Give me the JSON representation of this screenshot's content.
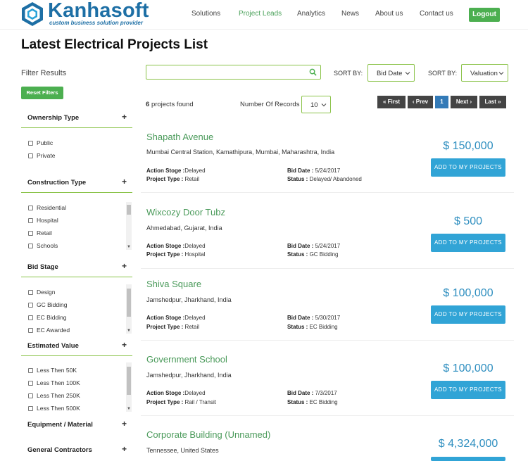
{
  "brand": {
    "name": "Kanhasoft",
    "tagline": "custom business solution provider",
    "colors": {
      "primary": "#1d6fa5",
      "accent": "#4aa15a",
      "button_green": "#4caf50",
      "button_blue": "#31a4d6"
    }
  },
  "nav": {
    "items": [
      {
        "label": "Solutions",
        "active": false
      },
      {
        "label": "Project Leads",
        "active": true
      },
      {
        "label": "Analytics",
        "active": false
      },
      {
        "label": "News",
        "active": false
      },
      {
        "label": "About us",
        "active": false
      },
      {
        "label": "Contact us",
        "active": false
      }
    ],
    "logout_label": "Logout"
  },
  "page": {
    "title": "Latest Electrical Projects List"
  },
  "sidebar": {
    "title": "Filter Results",
    "reset_label": "Reset Filters",
    "sections": [
      {
        "label": "Ownership Type",
        "options": [
          "Public",
          "Private"
        ]
      },
      {
        "label": "Construction Type",
        "options": [
          "Residential",
          "Hospital",
          "Retail",
          "Schools"
        ]
      },
      {
        "label": "Bid Stage",
        "options": [
          "Design",
          "GC Bidding",
          "EC Bidding",
          "EC Awarded"
        ]
      },
      {
        "label": "Estimated Value",
        "options": [
          "Less Then 50K",
          "Less Then 100K",
          "Less Then 250K",
          "Less Then 500K"
        ]
      },
      {
        "label": "Equipment / Material",
        "options": []
      },
      {
        "label": "General Contractors",
        "options": []
      }
    ],
    "expand_icon": "+"
  },
  "toolbar": {
    "search_placeholder": "",
    "sort_label_1": "SORT BY:",
    "sort_value_1": "Bid Date",
    "sort_label_2": "SORT BY:",
    "sort_value_2": "Valuation",
    "found_count": "6",
    "found_text": "projects found",
    "records_label": "Number Of Records",
    "records_value": "10"
  },
  "pagination": {
    "first": "« First",
    "prev": "‹ Prev",
    "current": "1",
    "next": "Next ›",
    "last": "Last »"
  },
  "projects": [
    {
      "title": "Shapath Avenue",
      "location": "Mumbai Central Station, Kamathipura, Mumbai, Maharashtra, India",
      "action_stage_label": "Action Stoge :",
      "action_stage": "Delayed",
      "project_type_label": "Project Type :",
      "project_type": "Retail",
      "bid_date_label": "Bid Date :",
      "bid_date": "5/24/2017",
      "status_label": "Status :",
      "status": "Delayed/ Abandoned",
      "valuation": "$ 150,000",
      "button": "ADD TO MY PROJECTS"
    },
    {
      "title": "Wixcozy Door Tubz",
      "location": "Ahmedabad, Gujarat, India",
      "action_stage_label": "Action Stoge :",
      "action_stage": "Delayed",
      "project_type_label": "Project Type :",
      "project_type": "Hospital",
      "bid_date_label": "Bid Date :",
      "bid_date": "5/24/2017",
      "status_label": "Status :",
      "status": "GC Bidding",
      "valuation": "$ 500",
      "button": "ADD TO MY PROJECTS"
    },
    {
      "title": "Shiva Square",
      "location": "Jamshedpur, Jharkhand, India",
      "action_stage_label": "Action Stoge :",
      "action_stage": "Delayed",
      "project_type_label": "Project Type :",
      "project_type": "Retail",
      "bid_date_label": "Bid Date :",
      "bid_date": "5/30/2017",
      "status_label": "Status :",
      "status": "EC Bidding",
      "valuation": "$ 100,000",
      "button": "ADD TO MY PROJECTS"
    },
    {
      "title": "Government School",
      "location": "Jamshedpur, Jharkhand, India",
      "action_stage_label": "Action Stoge :",
      "action_stage": "Delayed",
      "project_type_label": "Project Type :",
      "project_type": "Rail / Transit",
      "bid_date_label": "Bid Date :",
      "bid_date": "7/3/2017",
      "status_label": "Status :",
      "status": "EC Bidding",
      "valuation": "$ 100,000",
      "button": "ADD TO MY PROJECTS"
    },
    {
      "title": "Corporate Building (Unnamed)",
      "location": "Tennessee, United States",
      "valuation": "$ 4,324,000"
    }
  ]
}
